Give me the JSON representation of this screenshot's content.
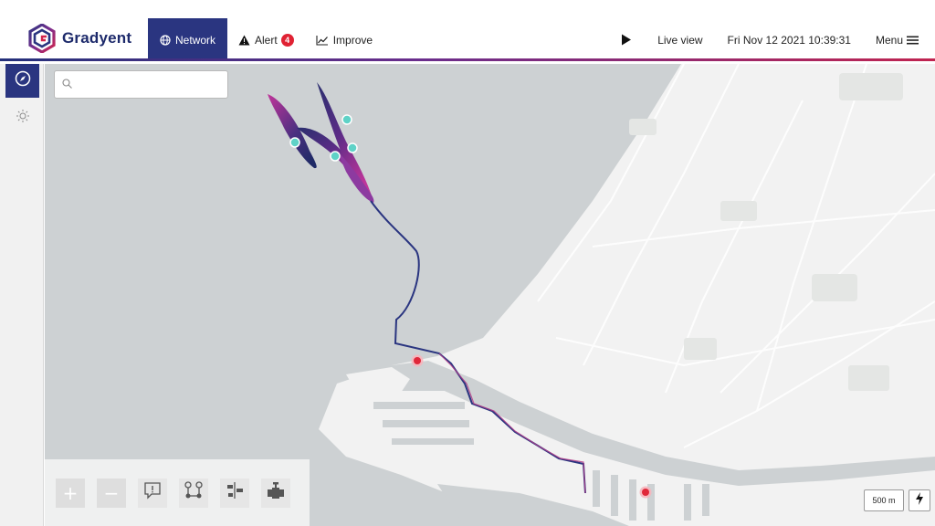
{
  "brand": {
    "name": "Gradyent",
    "logo_icon": "gradyent-logo-icon",
    "color": "#1d2a6b"
  },
  "nav": {
    "items": [
      {
        "label": "Network",
        "icon": "globe-icon",
        "active": true
      },
      {
        "label": "Alert",
        "icon": "warning-icon",
        "badge": "4"
      },
      {
        "label": "Improve",
        "icon": "trend-chart-icon"
      }
    ]
  },
  "header": {
    "play_icon": "play-icon",
    "live_view_label": "Live view",
    "datetime": "Fri Nov 12 2021 10:39:31",
    "menu_label": "Menu",
    "menu_icon": "hamburger-icon"
  },
  "sidebar": {
    "items": [
      {
        "icon": "compass-icon",
        "active": true
      },
      {
        "icon": "sun-icon",
        "active": false
      }
    ]
  },
  "search": {
    "placeholder": "",
    "value": "",
    "icon": "search-icon"
  },
  "map": {
    "water_color": "#cdd1d3",
    "land_color": "#f2f2f2",
    "pipeline_color": "#2a3580",
    "accent_color": "#b5294a",
    "scale_label": "500 m"
  },
  "toolbar": {
    "tools": [
      {
        "icon": "zoom-in-icon",
        "symbol": "+"
      },
      {
        "icon": "zoom-out-icon",
        "symbol": "−"
      },
      {
        "icon": "alert-message-icon"
      },
      {
        "icon": "route-nodes-icon"
      },
      {
        "icon": "layers-align-icon"
      },
      {
        "icon": "valve-icon"
      }
    ]
  }
}
